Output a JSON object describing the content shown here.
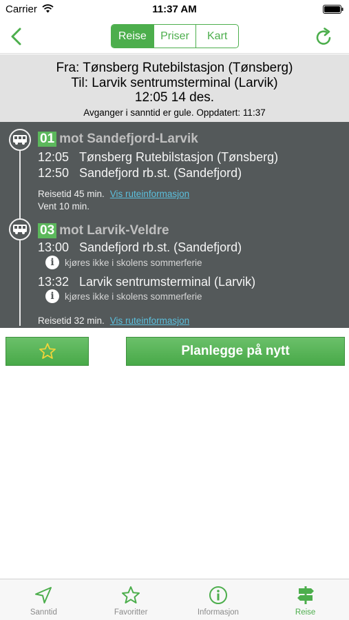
{
  "status": {
    "carrier": "Carrier",
    "time": "11:37 AM"
  },
  "nav": {
    "segments": [
      "Reise",
      "Priser",
      "Kart"
    ],
    "active_segment": "Reise"
  },
  "trip": {
    "from": "Fra: Tønsberg Rutebilstasjon (Tønsberg)",
    "to": "Til: Larvik sentrumsterminal (Larvik)",
    "datetime": "12:05 14 des.",
    "realtime_note": "Avganger i sanntid er gule. Oppdatert: 11:37"
  },
  "legs": [
    {
      "line": "01",
      "direction": "mot Sandefjord-Larvik",
      "stops": [
        {
          "time": "12:05",
          "name": "Tønsberg Rutebilstasjon (Tønsberg)"
        },
        {
          "time": "12:50",
          "name": "Sandefjord rb.st. (Sandefjord)"
        }
      ],
      "travel_time": "Reisetid 45 min.",
      "route_link": "Vis ruteinformasjon",
      "wait": "Vent 10 min."
    },
    {
      "line": "03",
      "direction": "mot Larvik-Veldre",
      "stops": [
        {
          "time": "13:00",
          "name": "Sandefjord rb.st. (Sandefjord)",
          "note": "kjøres ikke i skolens sommerferie"
        },
        {
          "time": "13:32",
          "name": "Larvik sentrumsterminal (Larvik)",
          "note": "kjøres ikke i skolens sommerferie"
        }
      ],
      "travel_time": "Reisetid 32 min.",
      "route_link": "Vis ruteinformasjon"
    }
  ],
  "actions": {
    "favorite_icon": "star-outline-icon",
    "replan_label": "Planlegge på nytt"
  },
  "tabbar": {
    "items": [
      {
        "label": "Sanntid",
        "icon": "location-arrow-icon"
      },
      {
        "label": "Favoritter",
        "icon": "star-icon"
      },
      {
        "label": "Informasjon",
        "icon": "info-icon"
      },
      {
        "label": "Reise",
        "icon": "signpost-icon"
      }
    ],
    "active": "Reise"
  },
  "colors": {
    "accent": "#4cae4c",
    "header_bg": "#e2e2e2",
    "legs_bg": "#54595a",
    "link": "#5bc0de"
  }
}
